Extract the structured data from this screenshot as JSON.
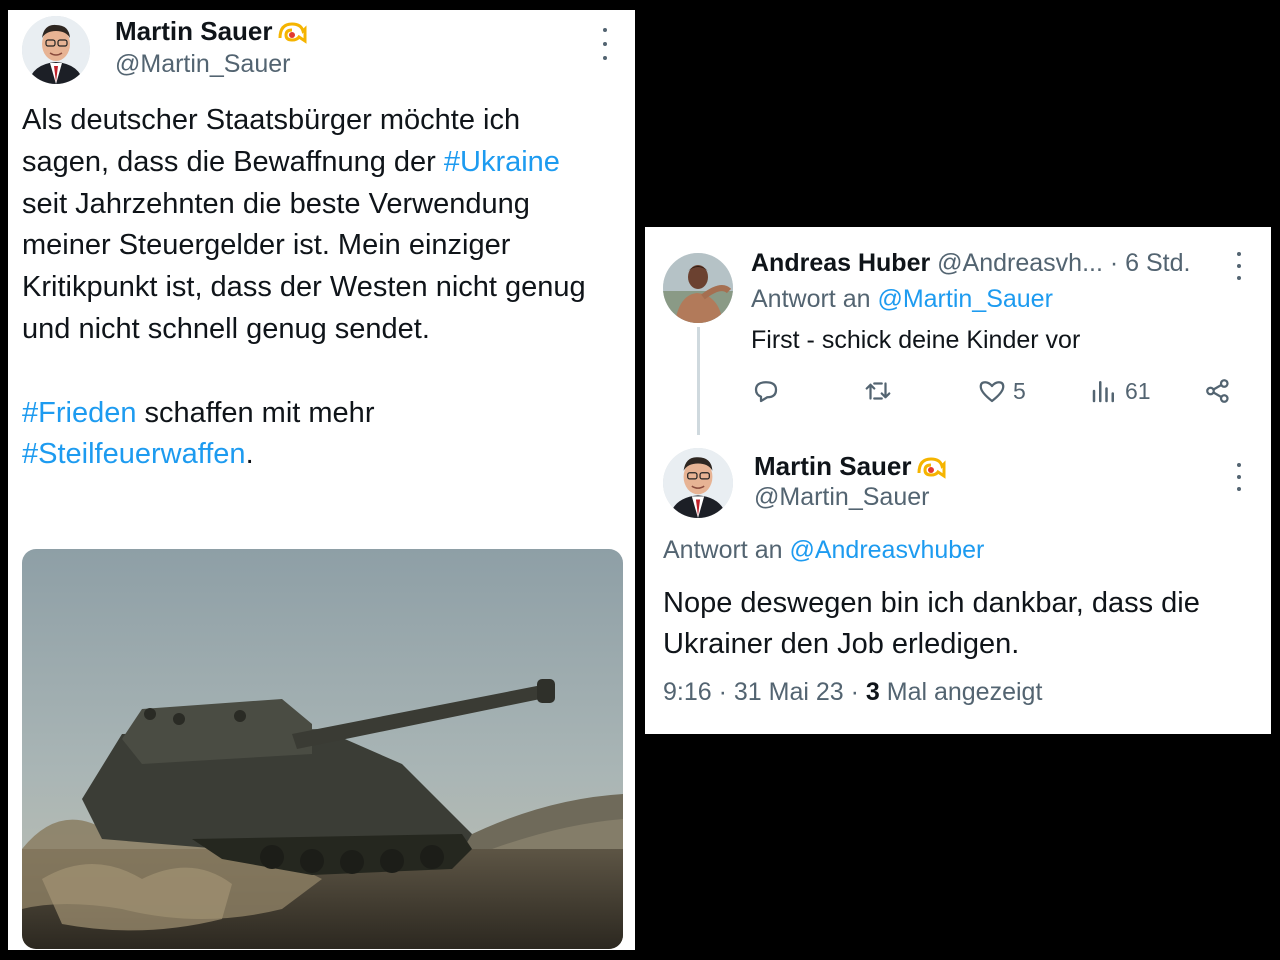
{
  "left_tweet": {
    "author_name": "Martin Sauer",
    "author_handle": "@Martin_Sauer",
    "text_line1": "Als deutscher Staatsbürger möchte ich sagen, dass die Bewaffnung der ",
    "hashtag1": "#Ukraine",
    "text_line2": " seit Jahrzehnten die beste Verwendung meiner Steuergelder ist. Mein einziger Kritikpunkt ist, dass der Westen nicht genug und nicht schnell genug sendet.",
    "hashtag2": "#Frieden",
    "text_line3": " schaffen mit mehr ",
    "hashtag3": "#Steilfeuerwaffen",
    "text_end": ".",
    "media_icon": "tank-photo"
  },
  "reply_tweet": {
    "author_name": "Andreas Huber",
    "author_handle": "@Andreasvh...",
    "time": "· 6 Std.",
    "reply_to_label": "Antwort an ",
    "reply_to_handle": "@Martin_Sauer",
    "text": "First - schick deine Kinder vor",
    "likes": "5",
    "views": "61"
  },
  "main_reply": {
    "author_name": "Martin Sauer",
    "author_handle": "@Martin_Sauer",
    "reply_to_label": "Antwort an ",
    "reply_to_handle": "@Andreasvhuber",
    "text": "Nope deswegen bin ich dankbar, dass die Ukrainer den Job erledigen.",
    "timestamp": "9:16 · 31 Mai 23 · ",
    "view_count": "3",
    "view_label": " Mal angezeigt"
  },
  "colors": {
    "link": "#1d9bf0",
    "muted": "#536471",
    "text": "#0f1419"
  }
}
